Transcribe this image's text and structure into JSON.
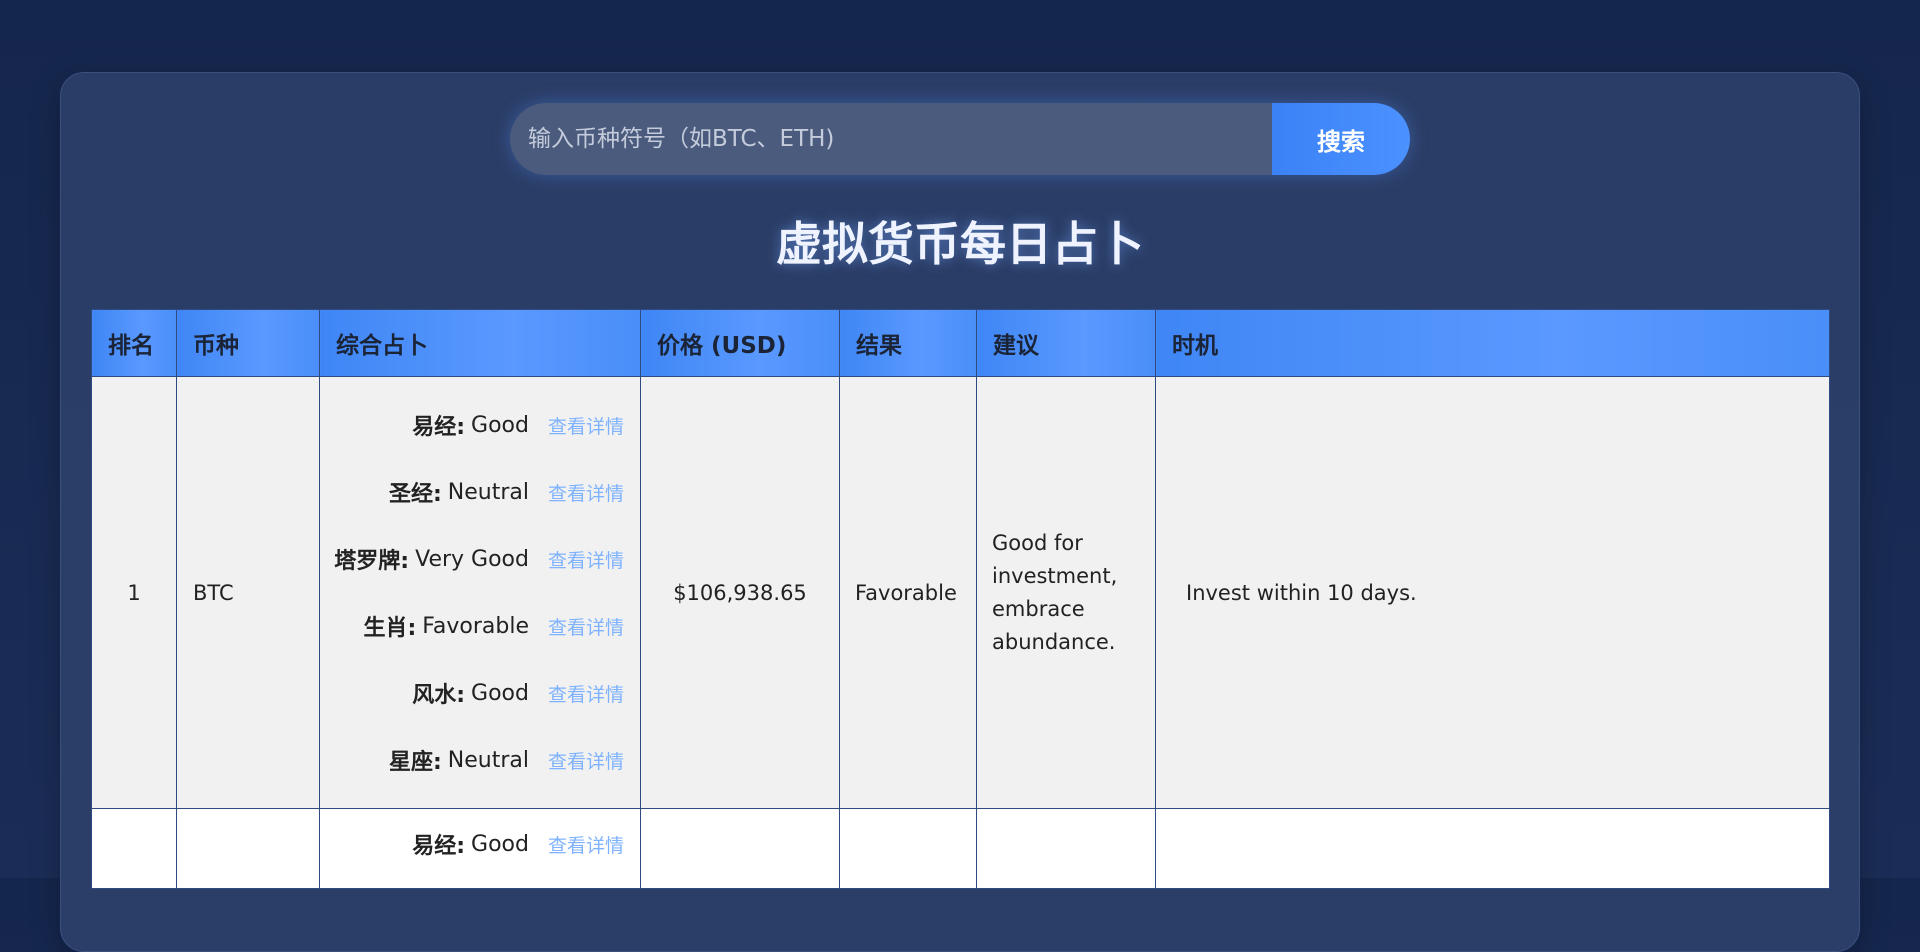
{
  "search": {
    "placeholder": "输入币种符号（如BTC、ETH)",
    "button_label": "搜索"
  },
  "page_title": "虚拟货币每日占卜",
  "table": {
    "headers": [
      "排名",
      "币种",
      "综合占卜",
      "价格 (USD)",
      "结果",
      "建议",
      "时机"
    ],
    "detail_link_label": "查看详情",
    "rows": [
      {
        "rank": "1",
        "symbol": "BTC",
        "divinations": [
          {
            "method": "易经:",
            "value": "Good"
          },
          {
            "method": "圣经:",
            "value": "Neutral"
          },
          {
            "method": "塔罗牌:",
            "value": "Very Good"
          },
          {
            "method": "生肖:",
            "value": "Favorable"
          },
          {
            "method": "风水:",
            "value": "Good"
          },
          {
            "method": "星座:",
            "value": "Neutral"
          }
        ],
        "price": "$106,938.65",
        "result": "Favorable",
        "advice": "Good for investment, embrace abundance.",
        "timing": "Invest within 10 days."
      },
      {
        "rank": "",
        "symbol": "",
        "divinations": [
          {
            "method": "易经:",
            "value": "Good"
          }
        ],
        "price": "",
        "result": "",
        "advice": "",
        "timing": ""
      }
    ]
  },
  "colors": {
    "page_bg": "#15264d",
    "panel_bg": "#2a3d66",
    "accent": "#3b82f6",
    "link": "#7fb3ff"
  }
}
